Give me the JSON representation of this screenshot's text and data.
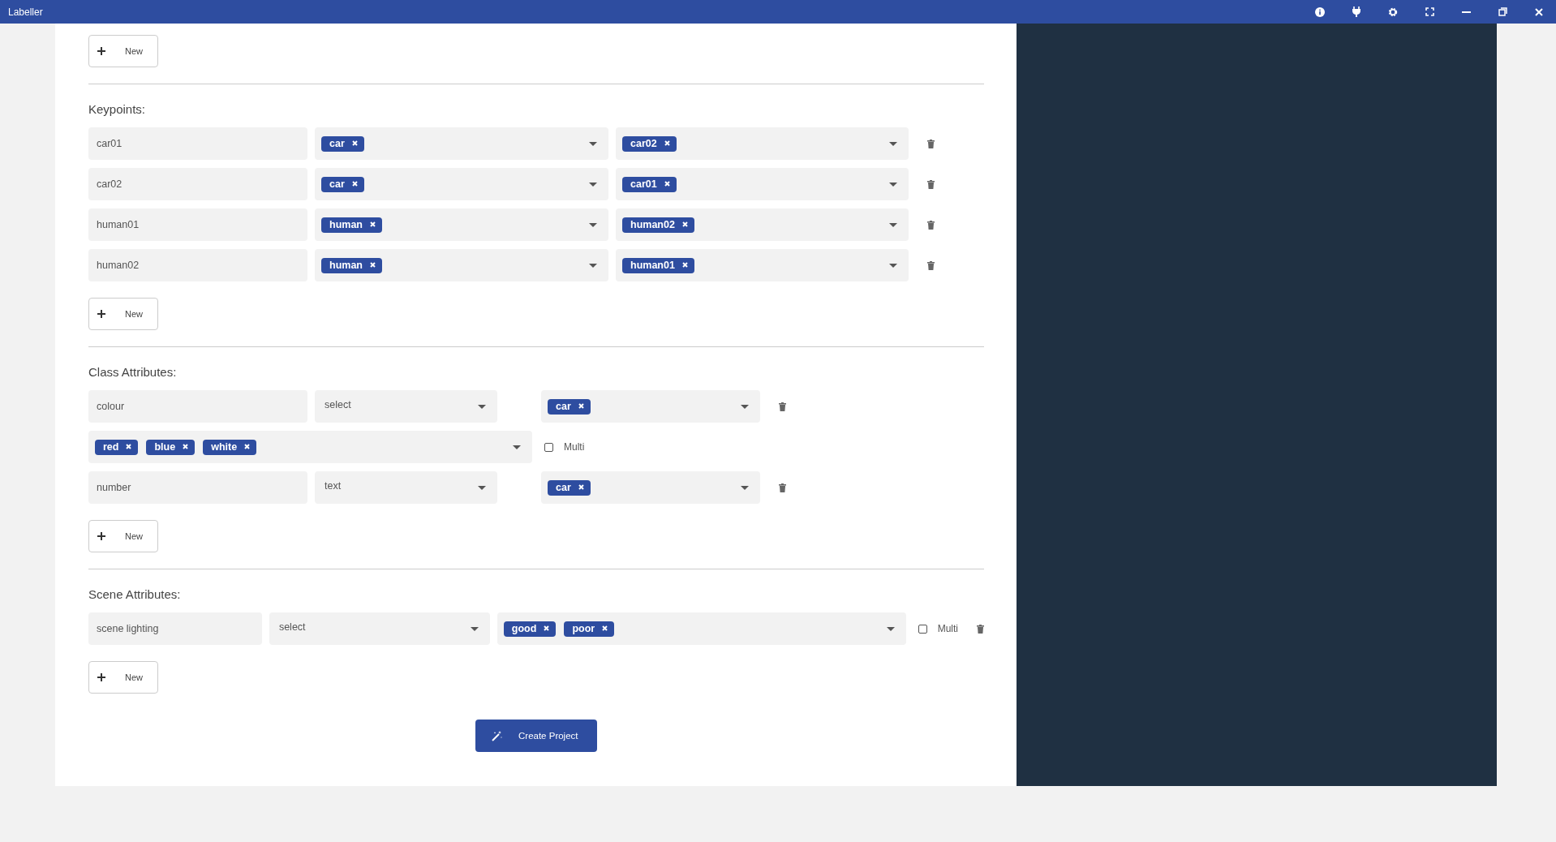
{
  "window": {
    "title": "Labeller"
  },
  "top_new_button": {
    "label": "New"
  },
  "keypoints": {
    "heading": "Keypoints:",
    "rows": [
      {
        "name": "car01",
        "classes": [
          "car"
        ],
        "links": [
          "car02"
        ]
      },
      {
        "name": "car02",
        "classes": [
          "car"
        ],
        "links": [
          "car01"
        ]
      },
      {
        "name": "human01",
        "classes": [
          "human"
        ],
        "links": [
          "human02"
        ]
      },
      {
        "name": "human02",
        "classes": [
          "human"
        ],
        "links": [
          "human01"
        ]
      }
    ],
    "new_button": {
      "label": "New"
    }
  },
  "class_attributes": {
    "heading": "Class Attributes:",
    "rows": [
      {
        "name": "colour",
        "type": "select",
        "classes": [
          "car"
        ],
        "options": [
          "red",
          "blue",
          "white"
        ],
        "multi": false,
        "multi_label": "Multi"
      },
      {
        "name": "number",
        "type": "text",
        "classes": [
          "car"
        ]
      }
    ],
    "new_button": {
      "label": "New"
    }
  },
  "scene_attributes": {
    "heading": "Scene Attributes:",
    "rows": [
      {
        "name": "scene lighting",
        "type": "select",
        "values": [
          "good",
          "poor"
        ],
        "multi": false,
        "multi_label": "Multi"
      }
    ],
    "new_button": {
      "label": "New"
    }
  },
  "create_button": {
    "label": "Create Project"
  }
}
